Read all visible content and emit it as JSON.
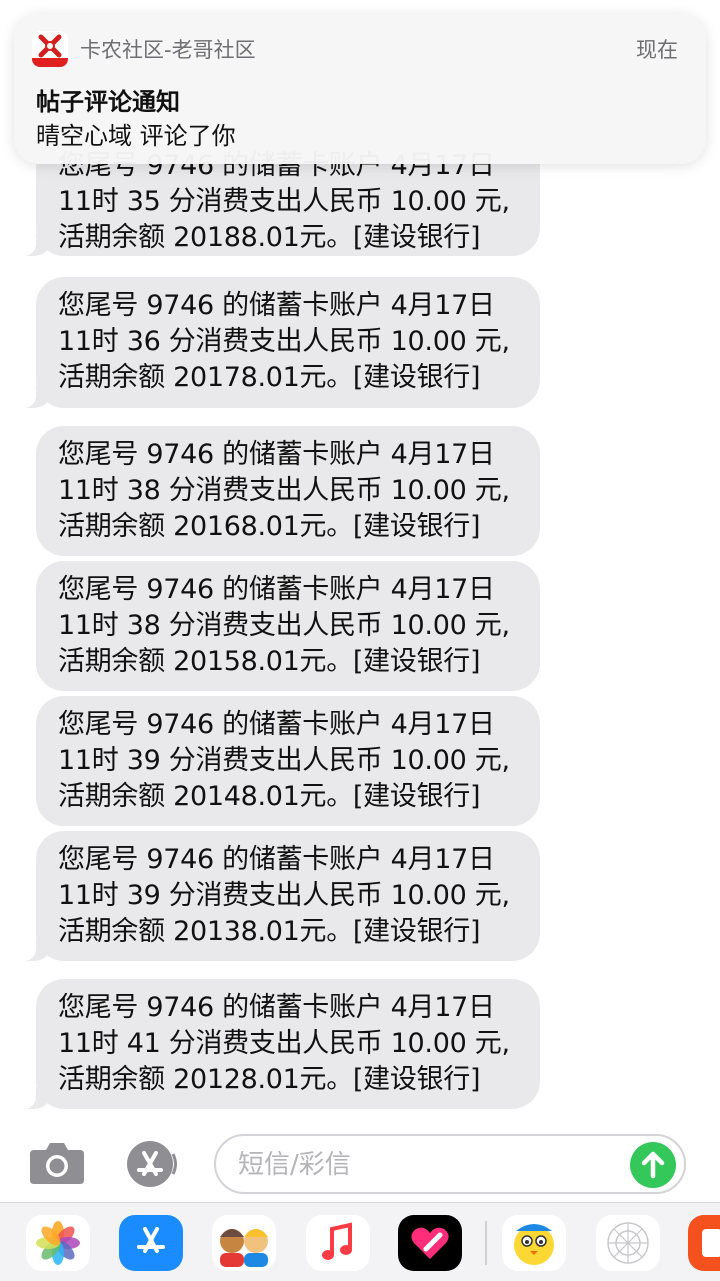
{
  "notification": {
    "app_name": "卡农社区-老哥社区",
    "time": "现在",
    "title": "帖子评论通知",
    "body": "晴空心域 评论了你"
  },
  "messages": [
    {
      "lines": [
        "您尾号 9746 的储蓄卡账户 4月17日",
        "11时 35 分消费支出人民币 10.00 元,",
        "活期余额 20188.01元。[建设银行]"
      ]
    },
    {
      "lines": [
        "您尾号 9746 的储蓄卡账户 4月17日",
        "11时 36 分消费支出人民币 10.00 元,",
        "活期余额 20178.01元。[建设银行]"
      ]
    },
    {
      "lines": [
        "您尾号 9746 的储蓄卡账户 4月17日",
        "11时 38 分消费支出人民币 10.00 元,",
        "活期余额 20168.01元。[建设银行]"
      ]
    },
    {
      "lines": [
        "您尾号 9746 的储蓄卡账户 4月17日",
        "11时 38 分消费支出人民币 10.00 元,",
        "活期余额 20158.01元。[建设银行]"
      ]
    },
    {
      "lines": [
        "您尾号 9746 的储蓄卡账户 4月17日",
        "11时 39 分消费支出人民币 10.00 元,",
        "活期余额 20148.01元。[建设银行]"
      ]
    },
    {
      "lines": [
        "您尾号 9746 的储蓄卡账户 4月17日",
        "11时 39 分消费支出人民币 10.00 元,",
        "活期余额 20138.01元。[建设银行]"
      ]
    },
    {
      "lines": [
        "您尾号 9746 的储蓄卡账户 4月17日",
        "11时 41 分消费支出人民币 10.00 元,",
        "活期余额 20128.01元。[建设银行]"
      ]
    }
  ],
  "input": {
    "placeholder": "短信/彩信",
    "value": ""
  },
  "toolbar": {
    "camera_icon": "camera-icon",
    "appstore_icon": "appstore-icon",
    "send_icon": "arrow-up-icon"
  },
  "drawer": {
    "apps": [
      "photos-icon",
      "appstore-icon",
      "memoji-icon",
      "music-icon",
      "digital-touch-icon",
      "sticker-icon",
      "grid-sticker-icon",
      "app-icon"
    ]
  },
  "colors": {
    "bubble": "#e9e9eb",
    "send": "#34c759",
    "appstore_blue": "#1a8cff"
  }
}
